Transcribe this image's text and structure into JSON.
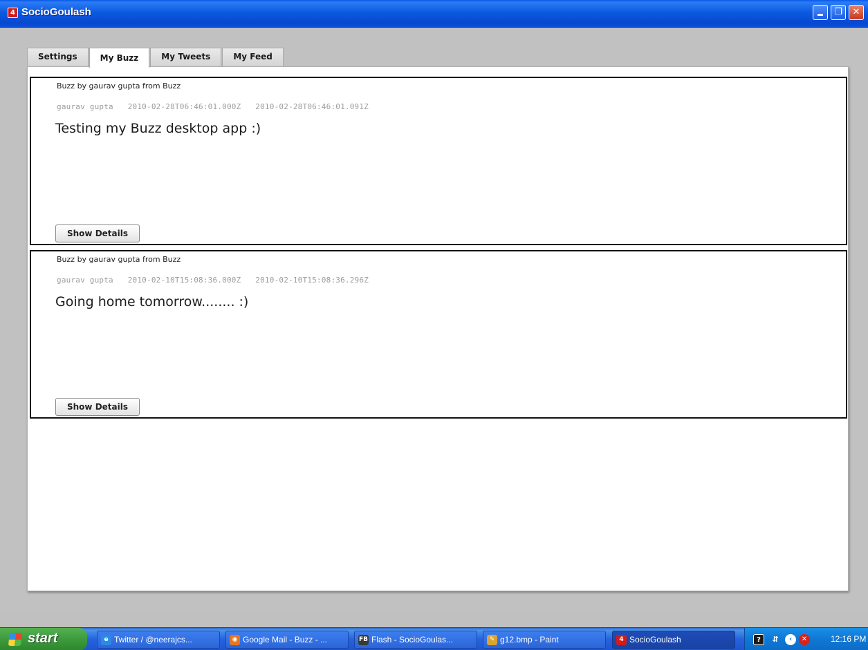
{
  "window": {
    "title": "SocioGoulash",
    "app_icon_glyph": "4",
    "controls": {
      "minimize": "minimize",
      "restore": "❐",
      "close": "✕"
    }
  },
  "tabs": [
    {
      "label": "Settings",
      "active": false
    },
    {
      "label": "My Buzz",
      "active": true
    },
    {
      "label": "My Tweets",
      "active": false
    },
    {
      "label": "My Feed",
      "active": false
    }
  ],
  "posts": [
    {
      "header": "Buzz by gaurav gupta from Buzz",
      "author": "gaurav gupta",
      "published": "2010-02-28T06:46:01.000Z",
      "updated": "2010-02-28T06:46:01.091Z",
      "body": "Testing my Buzz desktop app :)",
      "button": "Show Details"
    },
    {
      "header": "Buzz by gaurav gupta from Buzz",
      "author": "gaurav gupta",
      "published": "2010-02-10T15:08:36.000Z",
      "updated": "2010-02-10T15:08:36.296Z",
      "body": "Going home tomorrow........ :)",
      "button": "Show Details"
    }
  ],
  "taskbar": {
    "start_label": "start",
    "tasks": [
      {
        "label": "Twitter / @neerajcs...",
        "icon": "internet-explorer-icon",
        "glyph": "e",
        "color": "#2b8ae6"
      },
      {
        "label": "Google Mail - Buzz - ...",
        "icon": "firefox-icon",
        "glyph": "◉",
        "color": "#e8761f"
      },
      {
        "label": "Flash - SocioGoulas...",
        "icon": "flash-builder-icon",
        "glyph": "FB",
        "color": "#3a3a3a"
      },
      {
        "label": "g12.bmp - Paint",
        "icon": "paint-icon",
        "glyph": "✎",
        "color": "#d9a430"
      },
      {
        "label": "SocioGoulash",
        "icon": "air-app-icon",
        "glyph": "4",
        "color": "#d21b1b",
        "active": true
      }
    ],
    "clock": "12:16 PM"
  }
}
